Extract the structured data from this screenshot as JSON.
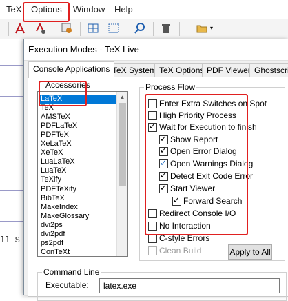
{
  "menu": [
    "TeX",
    "Options",
    "Window",
    "Help"
  ],
  "toolbar_icons": [
    "pdf-icon",
    "pdf-gear-icon",
    "settings-icon",
    "grid-icon",
    "grid-dots-icon",
    "search-icon",
    "delete-icon",
    "folder-icon"
  ],
  "editor_fragment": "ll S",
  "dialog": {
    "title": "Execution Modes - TeX Live",
    "tabs": [
      "Console Applications",
      "TeX System",
      "TeX Options",
      "PDF Viewer",
      "Ghostscript"
    ],
    "accessories_label": "Accessories",
    "accessories": [
      "LaTeX",
      "TeX",
      "AMSTeX",
      "PDFLaTeX",
      "PDFTeX",
      "XeLaTeX",
      "XeTeX",
      "LuaLaTeX",
      "LuaTeX",
      "TeXify",
      "PDFTeXify",
      "BibTeX",
      "MakeIndex",
      "MakeGlossary",
      "dvi2ps",
      "dvi2pdf",
      "ps2pdf",
      "ConTeXt"
    ],
    "selected_accessory": "LaTeX",
    "process_flow_label": "Process Flow",
    "options": [
      {
        "label": "Enter Extra Switches on Spot",
        "checked": false
      },
      {
        "label": "High Priority Process",
        "checked": false
      },
      {
        "label": "Wait for Execution to finish",
        "checked": true
      },
      {
        "label": "Show Report",
        "checked": true
      },
      {
        "label": "Open Error Dialog",
        "checked": true
      },
      {
        "label": "Open Warnings Dialog",
        "checked": true
      },
      {
        "label": "Detect Exit Code Error",
        "checked": true
      },
      {
        "label": "Start Viewer",
        "checked": true
      },
      {
        "label": "Forward Search",
        "checked": true
      },
      {
        "label": "Redirect Console I/O",
        "checked": false
      },
      {
        "label": "No Interaction",
        "checked": false
      },
      {
        "label": "C-style Errors",
        "checked": false
      },
      {
        "label": "Clean Build",
        "checked": false,
        "disabled": true
      }
    ],
    "apply_label": "Apply to All",
    "command_line_label": "Command Line",
    "executable_label": "Executable:",
    "executable_value": "latex.exe"
  }
}
